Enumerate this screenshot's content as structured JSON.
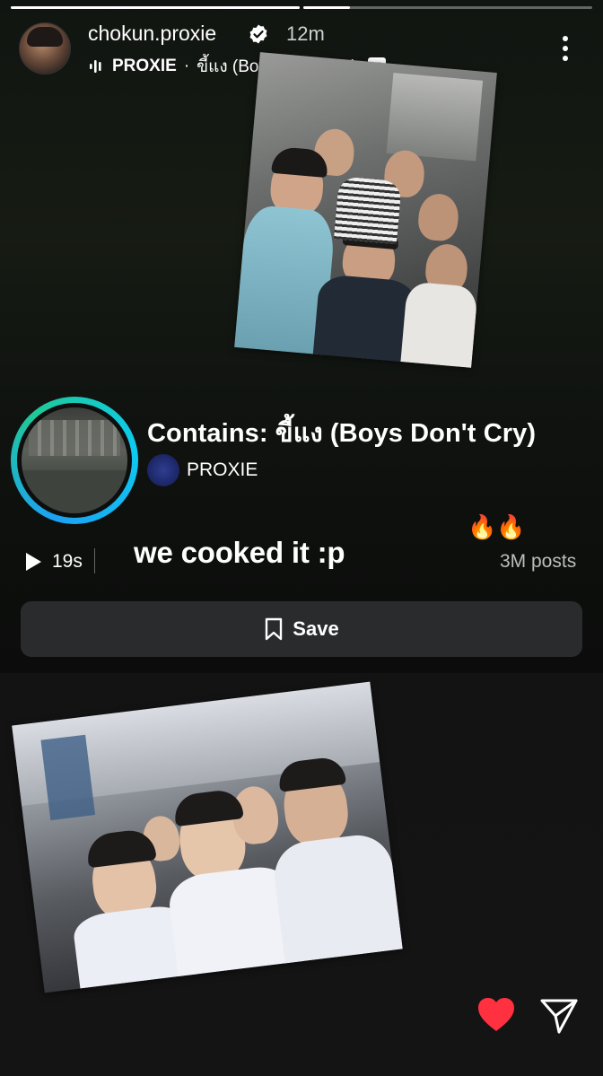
{
  "story": {
    "progress_segments": [
      {
        "fill": 1.0
      },
      {
        "fill": 0.16
      }
    ]
  },
  "header": {
    "username": "chokun.proxie",
    "time": "12m",
    "music_artist": "PROXIE",
    "music_separator": "·",
    "music_title": "ขี้แง (Boys Don't Cry)",
    "explicit_label": "E"
  },
  "music_sticker": {
    "contains_text": "Contains: ขี้แง (Boys Don't Cry)",
    "artist_name": "PROXIE"
  },
  "meta": {
    "duration": "19s",
    "caption": "we cooked it :p",
    "emoji": "🔥🔥",
    "posts_count": "3M posts"
  },
  "save_button": {
    "label": "Save"
  },
  "icons": {
    "verified": "verified-badge-icon",
    "audio": "audio-bars-icon",
    "more": "more-vertical-icon",
    "play": "play-icon",
    "bookmark": "bookmark-icon",
    "heart": "heart-icon",
    "send": "send-icon"
  },
  "colors": {
    "heart": "#ff3040",
    "ring_start": "#1da1f2",
    "ring_end": "#20c997"
  }
}
